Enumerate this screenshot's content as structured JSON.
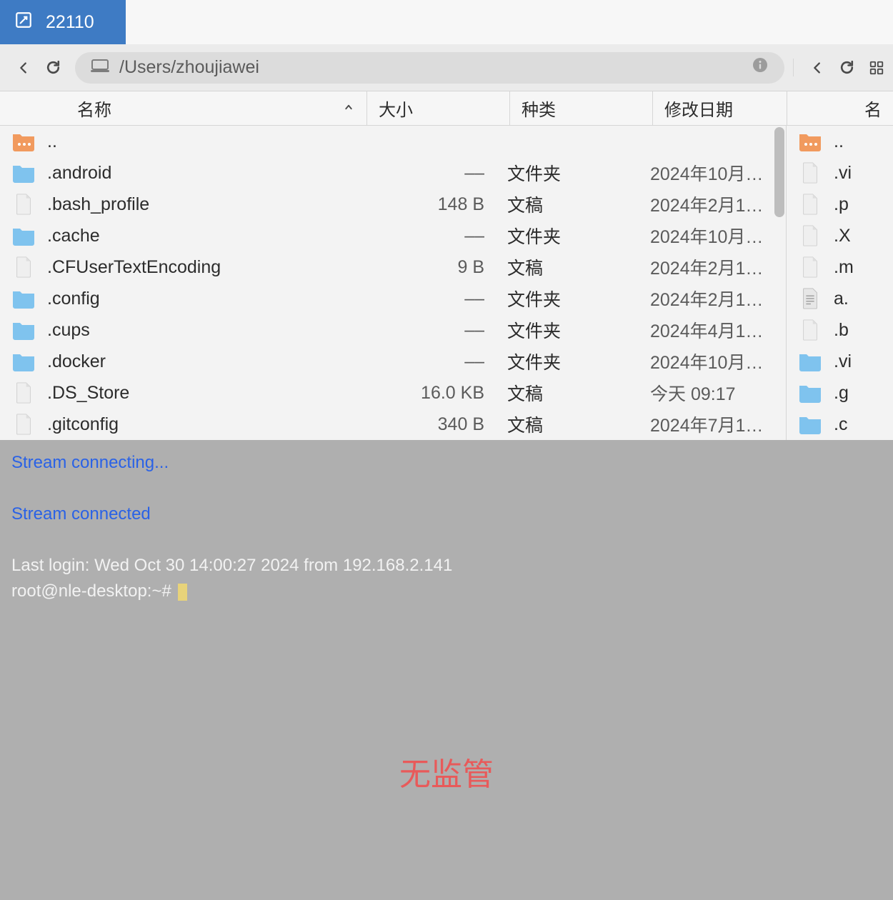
{
  "tab": {
    "title": "22110"
  },
  "left_pane": {
    "path": "/Users/zhoujiawei",
    "columns": {
      "name": "名称",
      "size": "大小",
      "kind": "种类",
      "date": "修改日期"
    },
    "files": [
      {
        "icon": "folder-up",
        "name": "..",
        "size": "",
        "kind": "",
        "date": ""
      },
      {
        "icon": "folder",
        "name": ".android",
        "size": "––",
        "kind": "文件夹",
        "date": "2024年10月…"
      },
      {
        "icon": "file",
        "name": ".bash_profile",
        "size": "148 B",
        "kind": "文稿",
        "date": "2024年2月1…"
      },
      {
        "icon": "folder",
        "name": ".cache",
        "size": "––",
        "kind": "文件夹",
        "date": "2024年10月…"
      },
      {
        "icon": "file",
        "name": ".CFUserTextEncoding",
        "size": "9 B",
        "kind": "文稿",
        "date": "2024年2月1…"
      },
      {
        "icon": "folder",
        "name": ".config",
        "size": "––",
        "kind": "文件夹",
        "date": "2024年2月1…"
      },
      {
        "icon": "folder",
        "name": ".cups",
        "size": "––",
        "kind": "文件夹",
        "date": "2024年4月1…"
      },
      {
        "icon": "folder",
        "name": ".docker",
        "size": "––",
        "kind": "文件夹",
        "date": "2024年10月…"
      },
      {
        "icon": "file",
        "name": ".DS_Store",
        "size": "16.0 KB",
        "kind": "文稿",
        "date": "今天 09:17"
      },
      {
        "icon": "file",
        "name": ".gitconfig",
        "size": "340 B",
        "kind": "文稿",
        "date": "2024年7月1…"
      }
    ]
  },
  "right_pane": {
    "columns": {
      "name": "名"
    },
    "files": [
      {
        "icon": "folder-up",
        "name": ".."
      },
      {
        "icon": "file",
        "name": ".vi"
      },
      {
        "icon": "file",
        "name": ".p"
      },
      {
        "icon": "file",
        "name": ".X"
      },
      {
        "icon": "file",
        "name": ".m"
      },
      {
        "icon": "textdoc",
        "name": "a."
      },
      {
        "icon": "file",
        "name": ".b"
      },
      {
        "icon": "folder",
        "name": ".vi"
      },
      {
        "icon": "folder",
        "name": ".g"
      },
      {
        "icon": "folder",
        "name": ".c"
      }
    ]
  },
  "terminal": {
    "line1": "Stream connecting...",
    "line2": "Stream connected",
    "line3": "Last login: Wed Oct 30 14:00:27 2024 from 192.168.2.141",
    "prompt": "root@nle-desktop:~# ",
    "watermark": "无监管"
  }
}
